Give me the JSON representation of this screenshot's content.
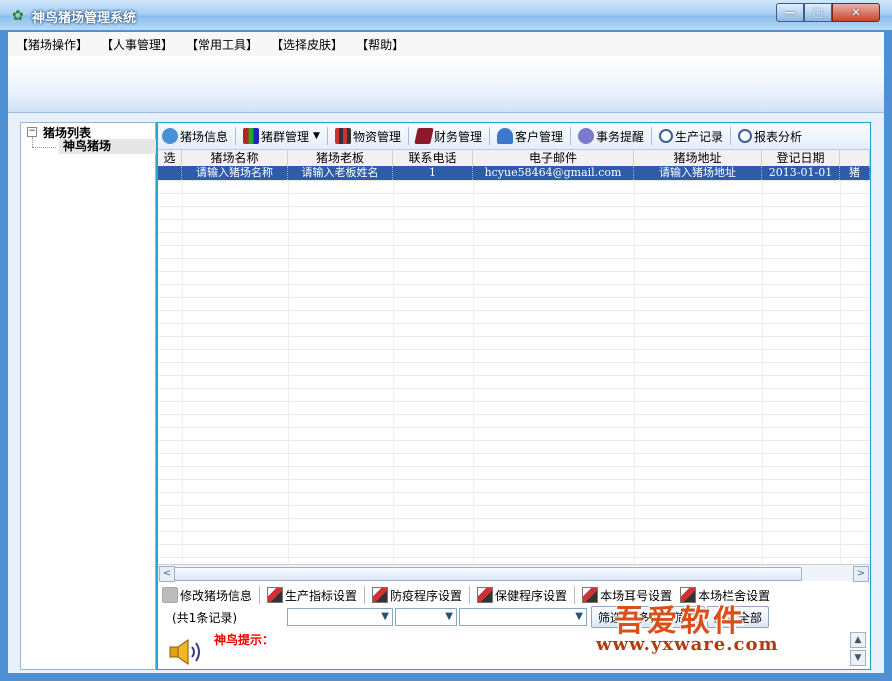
{
  "window": {
    "title": "神鸟猪场管理系统",
    "controls": {
      "minimize": "—",
      "maximize": "□",
      "close": "✕"
    }
  },
  "menu": [
    "【猪场操作】",
    "【人事管理】",
    "【常用工具】",
    "【选择皮肤】",
    "【帮助】"
  ],
  "tree": {
    "root": "猪场列表",
    "child": "神鸟猪场",
    "expander": "−"
  },
  "toolbar": {
    "items": [
      {
        "label": "猪场信息",
        "icon": "info-icon"
      },
      {
        "label": "猪群管理",
        "icon": "herd-icon",
        "dropdown": true
      },
      {
        "label": "物资管理",
        "icon": "goods-icon"
      },
      {
        "label": "财务管理",
        "icon": "finance-icon"
      },
      {
        "label": "客户管理",
        "icon": "customer-icon"
      },
      {
        "label": "事务提醒",
        "icon": "gear-icon"
      },
      {
        "label": "生产记录",
        "icon": "magnifier-icon"
      },
      {
        "label": "报表分析",
        "icon": "magnifier-icon"
      }
    ]
  },
  "grid": {
    "columns": [
      "选",
      "猪场名称",
      "猪场老板",
      "联系电话",
      "电子邮件",
      "猪场地址",
      "登记日期",
      ""
    ],
    "rows": [
      [
        "",
        "请输入猪场名称",
        "请输入老板姓名",
        "1",
        "hcyue58464@gmail.com",
        "请输入猪场地址",
        "2013-01-01",
        "猪"
      ]
    ],
    "scroll": {
      "left": "<",
      "right": ">"
    }
  },
  "actions": [
    "修改猪场信息",
    "生产指标设置",
    "防疫程序设置",
    "保健程序设置",
    "本场耳号设置",
    "本场栏舍设置"
  ],
  "filter": {
    "record_count": "(共1条记录)",
    "buttons": [
      "筛选",
      "多条件筛选",
      "显示全部"
    ]
  },
  "hint": {
    "label": "神鸟提示："
  },
  "watermark": {
    "brand": "吾爱软件",
    "url": "www.yxware.com"
  }
}
